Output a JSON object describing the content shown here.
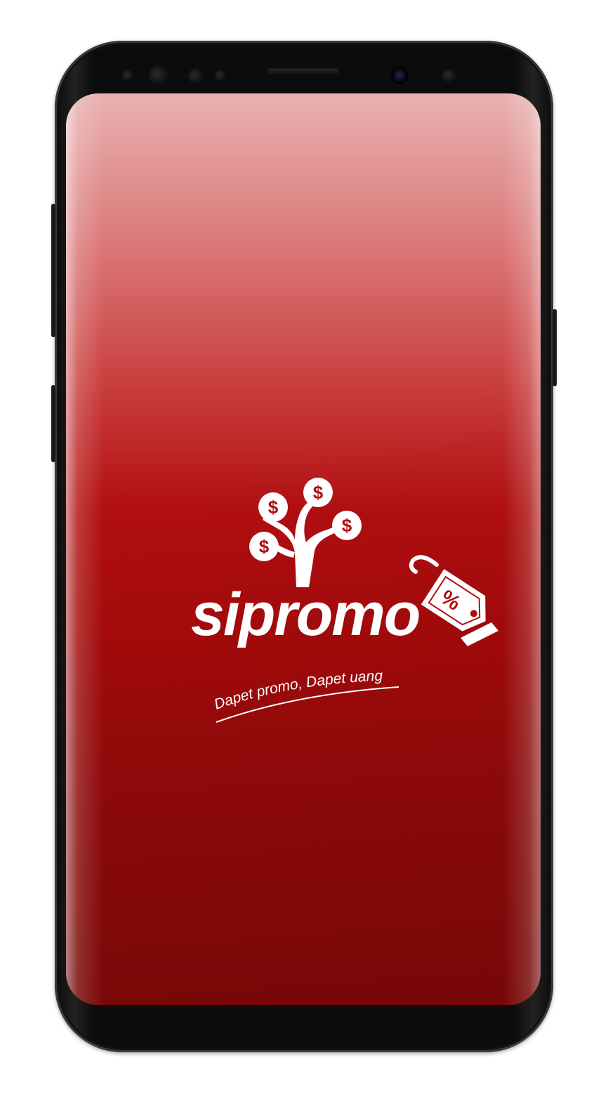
{
  "app": {
    "name": "sipromo",
    "tagline": "Dapet promo, Dapet uang"
  },
  "colors": {
    "screen_top": "#e9b2b2",
    "screen_mid": "#b10e10",
    "screen_bottom": "#820808",
    "logo": "#ffffff",
    "phone_body": "#0c0c0c"
  },
  "icons": {
    "logo_tree": "money-tree-icon",
    "logo_tag": "discount-tag-icon"
  }
}
